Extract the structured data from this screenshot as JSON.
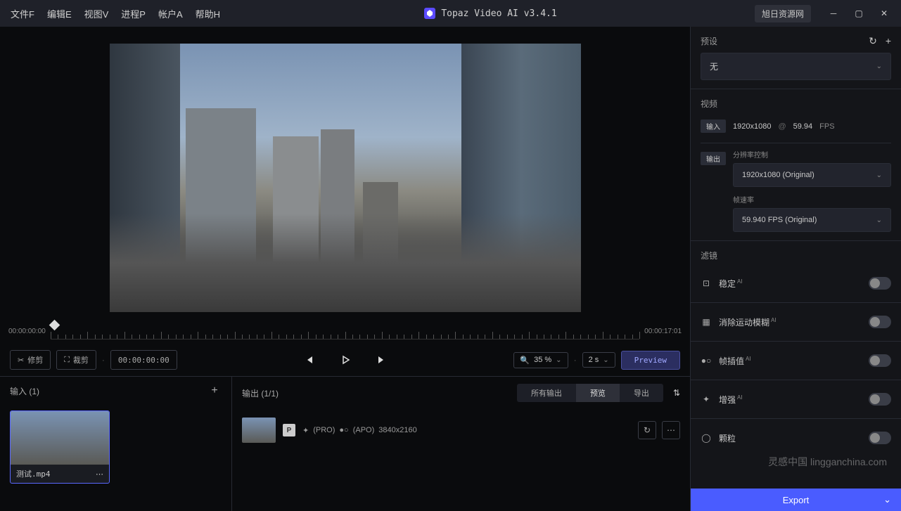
{
  "menu": [
    "文件F",
    "编辑E",
    "视图V",
    "进程P",
    "帐户A",
    "帮助H"
  ],
  "appTitle": "Topaz Video AI  v3.4.1",
  "linkBtn": "旭日资源网",
  "timeline": {
    "start": "00:00:00:00",
    "end": "00:00:17:01"
  },
  "controls": {
    "trim": "修剪",
    "crop": "裁剪",
    "timecode": "00:00:00:00",
    "zoom": "35 %",
    "duration": "2 s",
    "preview": "Preview"
  },
  "inputs": {
    "title": "输入 (1)",
    "file": "测试.mp4"
  },
  "outputs": {
    "title": "输出 (1/1)",
    "tabs": [
      "所有输出",
      "预览",
      "导出"
    ],
    "item": {
      "badge": "P",
      "tag1": "(PRO)",
      "tag2": "(APO)",
      "res": "3840x2160"
    }
  },
  "side": {
    "presets": {
      "label": "预设",
      "value": "无"
    },
    "video": {
      "label": "视频",
      "inLabel": "输入",
      "res": "1920x1080",
      "at": "@",
      "fps": "59.94",
      "fpsUnit": "FPS",
      "outLabel": "输出",
      "resCtrl": "分辨率控制",
      "resolution": "1920x1080 (Original)",
      "frLabel": "帧速率",
      "framerate": "59.940 FPS (Original)"
    },
    "filtersLabel": "滤镜",
    "filters": [
      {
        "name": "稳定",
        "ai": true
      },
      {
        "name": "消除运动模糊",
        "ai": true
      },
      {
        "name": "帧插值",
        "ai": true
      },
      {
        "name": "增强",
        "ai": true
      },
      {
        "name": "颗粒",
        "ai": false
      }
    ],
    "export": "Export"
  },
  "watermark": "灵感中国 lingganchina.com"
}
